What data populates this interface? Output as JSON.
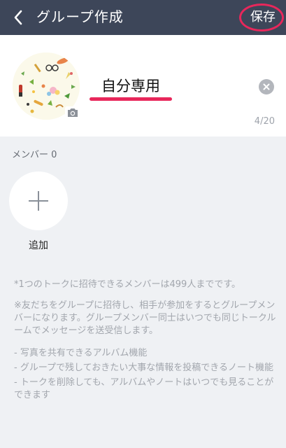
{
  "header": {
    "title": "グループ作成",
    "back_icon": "chevron-left-icon",
    "save_label": "保存"
  },
  "group": {
    "name": "自分専用",
    "char_count": "4/20",
    "photo_icon": "camera-icon",
    "clear_icon": "clear-icon"
  },
  "members": {
    "label": "メンバー 0",
    "add_label": "追加",
    "add_icon": "plus-icon"
  },
  "notes": {
    "limit": "*1つのトークに招待できるメンバーは499人までです。",
    "about": "※友だちをグループに招待し、相手が参加をするとグループメンバーになります。グループメンバー同士はいつでも同じトークルームでメッセージを送受信します。",
    "features": [
      "- 写真を共有できるアルバム機能",
      "- グループで残しておきたい大事な情報を投稿できるノート機能",
      "- トークを削除しても、アルバムやノートはいつでも見ることができます"
    ]
  },
  "colors": {
    "header_bg": "#3d4659",
    "annotation": "#e8275b",
    "page_bg": "#eff1f4"
  }
}
